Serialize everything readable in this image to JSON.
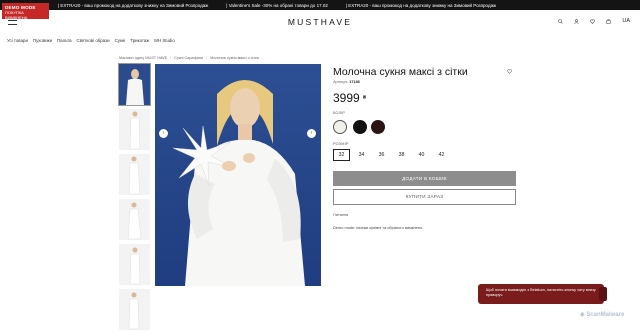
{
  "promo": {
    "items": [
      "| EXTRA20 - ваш промокод на додаткову знижку на Зимовий Розпродаж",
      "| Valentine's Sale -30% на обрані товари до 17.02",
      "| EXTRA20 - ваш промокод на додаткову знижку на Зимовий Розпродаж"
    ]
  },
  "demo": {
    "line1": "DEMO MODE",
    "line2": "ПОКУПКА ВИМКНЕНА"
  },
  "header": {
    "logo": "MUSTHAVE",
    "lang": "UA"
  },
  "nav": [
    "Усі товари",
    "Пуховики",
    "Пальта",
    "Святкові образи",
    "Сукні",
    "Трикотаж",
    "MH Studio"
  ],
  "breadcrumbs": [
    "Магазин одягу MUST HAVE",
    "Сукні Сарафани",
    "Молочна сукня максі з сітки"
  ],
  "product": {
    "title": "Молочна сукня максі з сітки",
    "article_label": "Артикул:",
    "article": "17186",
    "price": "3999",
    "currency": "₴",
    "color_label": "КОЛІР",
    "size_label": "РОЗМІР",
    "sizes": [
      "32",
      "34",
      "36",
      "38",
      "40",
      "42"
    ],
    "selected_size": "32",
    "add_to_cart": "ДОДАТИ В КОШИК",
    "buy_fast": "КУПИТИ ЗАРАЗ",
    "description_heading": "Питання",
    "demo_note": "Demo mode: кнопки купівлі та обраного вимкнено."
  },
  "colors": {
    "swatches": [
      "#f2f0ea",
      "#111111",
      "#2a1414"
    ],
    "accent": "#7a1c1c",
    "cart_button": "#8d8d8d"
  },
  "chat": {
    "text": "Щоб почати взаємодію з Belakum, натисніть кнопку чату внизу праворуч."
  },
  "watermark": "ScanMalware"
}
